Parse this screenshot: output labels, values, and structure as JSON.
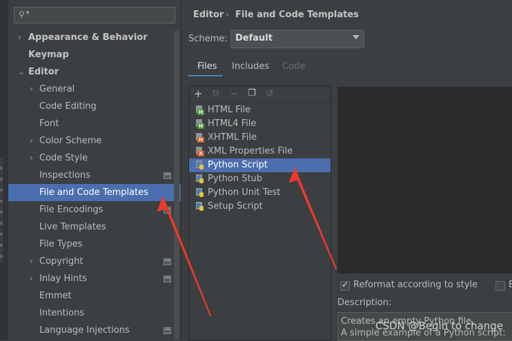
{
  "settings": {
    "search": {
      "placeholder": ""
    },
    "tree": [
      {
        "label": "Appearance & Behavior",
        "expander": "›",
        "bold": true
      },
      {
        "label": "Keymap",
        "bold": true
      },
      {
        "label": "Editor",
        "expander": "⌄",
        "bold": true
      },
      {
        "label": "General",
        "expander": "›"
      },
      {
        "label": "Code Editing"
      },
      {
        "label": "Font"
      },
      {
        "label": "Color Scheme",
        "expander": "›"
      },
      {
        "label": "Code Style",
        "expander": "›"
      },
      {
        "label": "Inspections",
        "project_icon": true
      },
      {
        "label": "File and Code Templates",
        "selected": true
      },
      {
        "label": "File Encodings",
        "project_icon": true
      },
      {
        "label": "Live Templates"
      },
      {
        "label": "File Types"
      },
      {
        "label": "Copyright",
        "expander": "›",
        "project_icon": true
      },
      {
        "label": "Inlay Hints",
        "expander": "›",
        "project_icon": true
      },
      {
        "label": "Emmet"
      },
      {
        "label": "Intentions"
      },
      {
        "label": "Language Injections",
        "project_icon": true
      }
    ]
  },
  "breadcrumb": {
    "parent": "Editor",
    "current": "File and Code Templates",
    "separator": "›"
  },
  "scheme": {
    "label": "Scheme:",
    "value": "Default"
  },
  "tabs": {
    "files": "Files",
    "includes": "Includes",
    "code": "Code"
  },
  "toolbar": {
    "add": "+",
    "copy": "⧉",
    "remove": "−",
    "duplicate": "❐",
    "reset": "↺"
  },
  "templates": [
    {
      "name": "HTML File",
      "tag": "H",
      "color": "#4e9a3e"
    },
    {
      "name": "HTML4 File",
      "tag": "H",
      "color": "#4e9a3e"
    },
    {
      "name": "XHTML File",
      "tag": "H",
      "color": "#d6602a"
    },
    {
      "name": "XML Properties File",
      "tag": "X",
      "color": "#d6602a"
    },
    {
      "name": "Python Script",
      "python": true,
      "selected": true
    },
    {
      "name": "Python Stub",
      "python": true
    },
    {
      "name": "Python Unit Test",
      "python": true
    },
    {
      "name": "Setup Script",
      "python": true
    }
  ],
  "options": {
    "reformat_label": "Reformat according to style",
    "reformat_checked": true,
    "second_label_fragment": "E"
  },
  "description": {
    "label": "Description:",
    "line1": "Creates an empty Python file.",
    "line2": "A simple example of a Python script:"
  },
  "watermark": "CSDN @Begin to change",
  "colors": {
    "selection": "#4b6eaf",
    "accent": "#4a88c7",
    "annotation_arrow": "#f0392b"
  }
}
